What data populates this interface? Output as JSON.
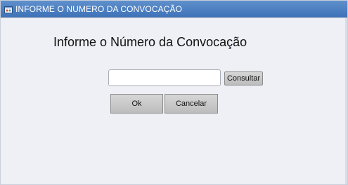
{
  "window": {
    "title": "INFORME O NUMERO DA CONVOCAÇÃO",
    "icon": "app-window-icon"
  },
  "dialog": {
    "heading": "Informe o Número da Convocação",
    "number_input": {
      "value": "",
      "placeholder": ""
    },
    "consultar_label": "Consultar",
    "ok_label": "Ok",
    "cancel_label": "Cancelar"
  },
  "colors": {
    "titlebar": "#4a7fc1",
    "background": "#eef0f5",
    "button": "#c8c8c8"
  }
}
